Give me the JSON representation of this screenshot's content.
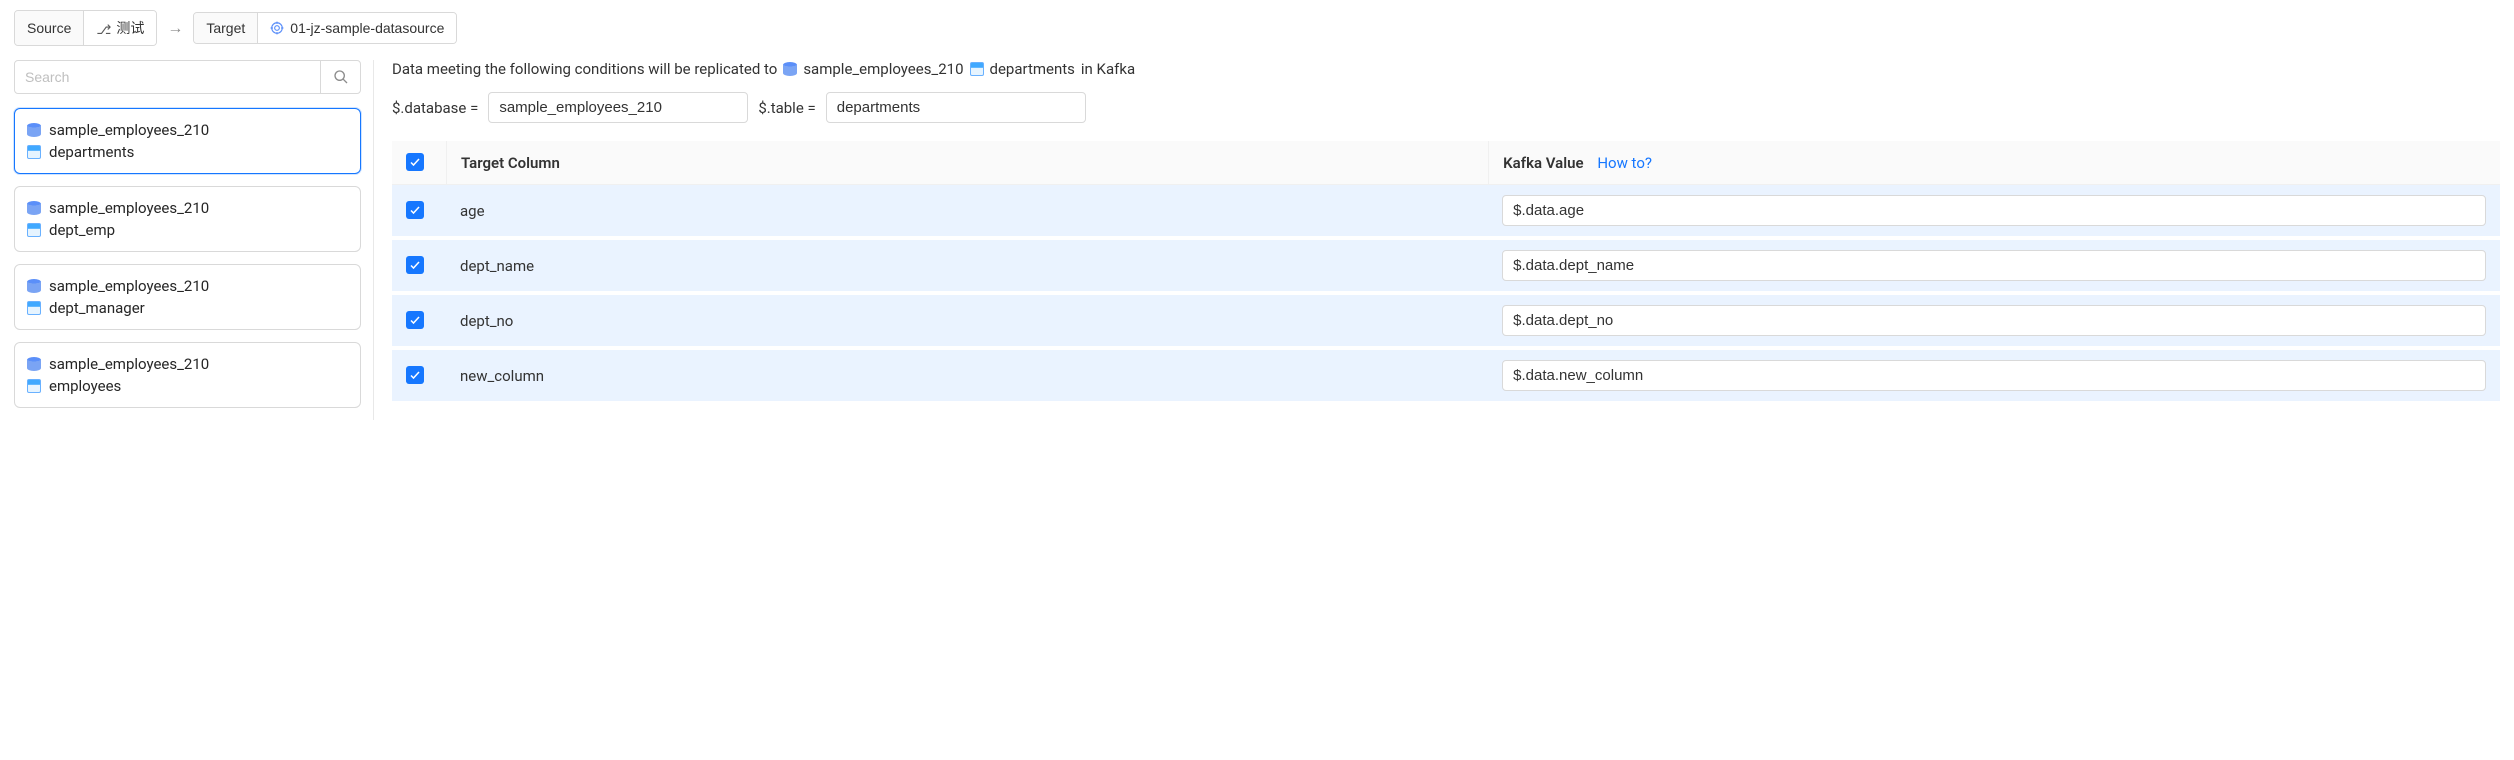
{
  "topbar": {
    "source_label": "Source",
    "test_label": "测试",
    "target_label": "Target",
    "datasource_label": "01-jz-sample-datasource"
  },
  "sidebar": {
    "search_placeholder": "Search",
    "items": [
      {
        "db": "sample_employees_210",
        "table": "departments",
        "selected": true
      },
      {
        "db": "sample_employees_210",
        "table": "dept_emp",
        "selected": false
      },
      {
        "db": "sample_employees_210",
        "table": "dept_manager",
        "selected": false
      },
      {
        "db": "sample_employees_210",
        "table": "employees",
        "selected": false
      }
    ]
  },
  "main": {
    "desc_prefix": "Data meeting the following conditions will be replicated to",
    "desc_db": "sample_employees_210",
    "desc_table": "departments",
    "desc_suffix": "in Kafka",
    "filter_db_label": "$.database =",
    "filter_db_value": "sample_employees_210",
    "filter_table_label": "$.table =",
    "filter_table_value": "departments",
    "columns": {
      "target": "Target Column",
      "value": "Kafka Value",
      "howto": "How to?"
    },
    "rows": [
      {
        "target": "age",
        "value": "$.data.age"
      },
      {
        "target": "dept_name",
        "value": "$.data.dept_name"
      },
      {
        "target": "dept_no",
        "value": "$.data.dept_no"
      },
      {
        "target": "new_column",
        "value": "$.data.new_column"
      }
    ]
  }
}
